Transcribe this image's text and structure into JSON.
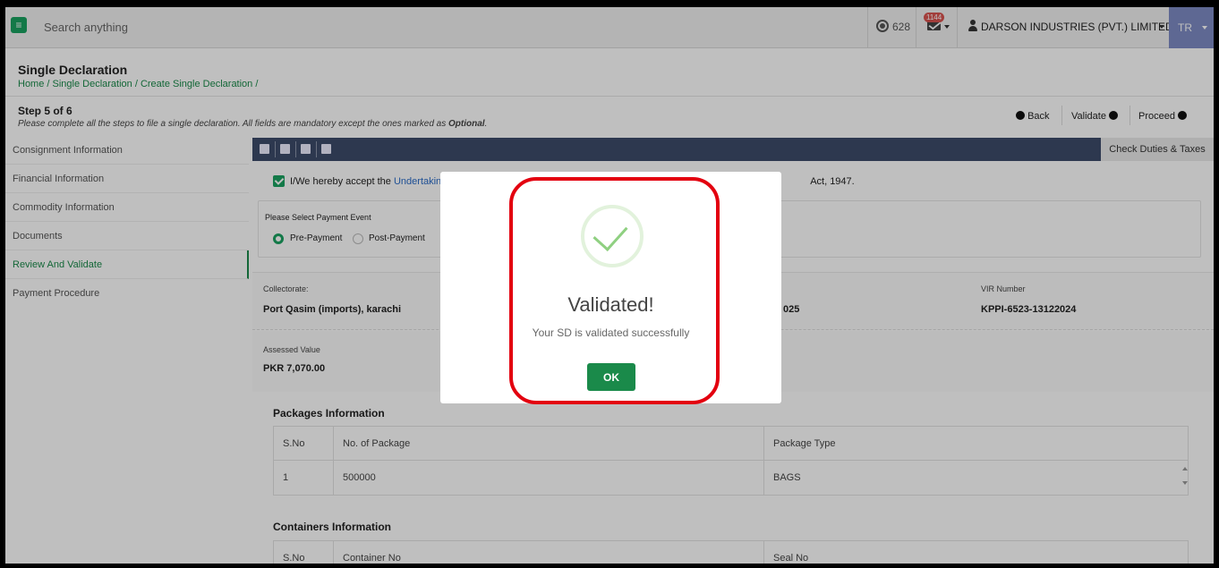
{
  "topbar": {
    "search_placeholder": "Search anything",
    "coin_count": "628",
    "mail_badge": "1144",
    "company": "DARSON INDUSTRIES (PVT.) LIMITED",
    "user_initials": "TR"
  },
  "header": {
    "title": "Single Declaration",
    "breadcrumb": "Home / Single Declaration / Create Single Declaration /",
    "step": "Step 5 of 6",
    "step_desc": "Please complete all the steps to file a single declaration. All fields are mandatory except the ones marked as ",
    "optional_word": "Optional",
    "step_desc_end": "."
  },
  "actions": {
    "back": "Back",
    "validate": "Validate",
    "proceed": "Proceed"
  },
  "sidebar": {
    "items": [
      {
        "label": "Consignment Information"
      },
      {
        "label": "Financial Information"
      },
      {
        "label": "Commodity Information"
      },
      {
        "label": "Documents"
      },
      {
        "label": "Review And Validate"
      },
      {
        "label": "Payment Procedure"
      }
    ]
  },
  "toolbar": {
    "check_duties": "Check Duties & Taxes"
  },
  "undertaking": {
    "prefix": "I/We hereby accept the ",
    "link": "Undertakin",
    "suffix": "Act, 1947."
  },
  "payment": {
    "label": "Please Select Payment Event",
    "options": [
      "Pre-Payment",
      "Post-Payment"
    ],
    "selected": "Pre-Payment"
  },
  "info": {
    "collectorate_label": "Collectorate:",
    "collectorate_value": "Port Qasim (imports), karachi",
    "partial_value": "025",
    "vir_label": "VIR Number",
    "vir_value": "KPPI-6523-13122024",
    "assessed_label": "Assessed Value",
    "assessed_value": "PKR 7,070.00"
  },
  "packages": {
    "title": "Packages Information",
    "headers": [
      "S.No",
      "No. of Package",
      "Package Type"
    ],
    "rows": [
      [
        "1",
        "500000",
        "BAGS"
      ]
    ]
  },
  "containers": {
    "title": "Containers Information",
    "headers": [
      "S.No",
      "Container No",
      "Seal No"
    ]
  },
  "modal": {
    "title": "Validated!",
    "message": "Your SD is validated successfully",
    "ok": "OK"
  },
  "colors": {
    "accent": "#1aa260",
    "toolbar": "#3d4b6a",
    "highlight": "#e3000f"
  }
}
